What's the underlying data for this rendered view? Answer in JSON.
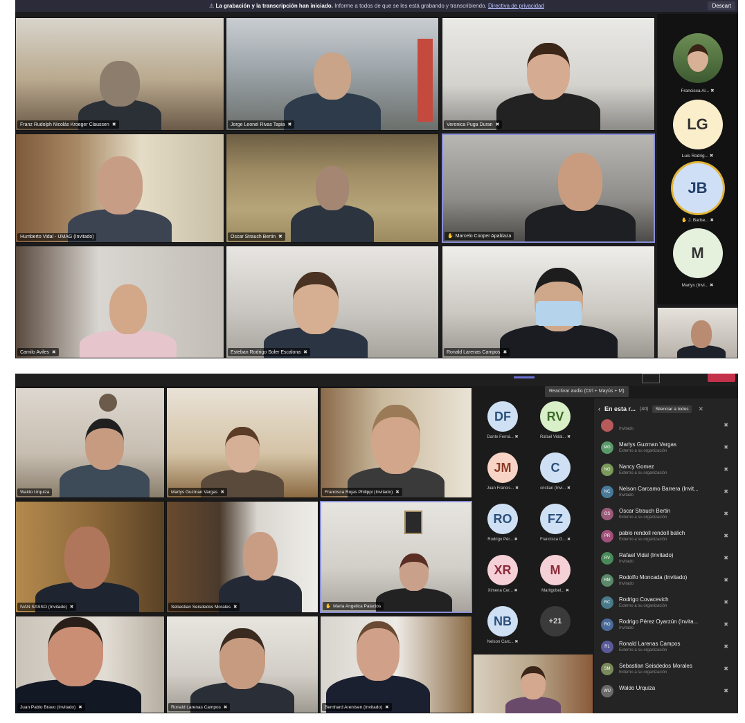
{
  "zoom": {
    "banner": {
      "title": "La grabación y la transcripción han iniciado.",
      "text": "Informe a todos de que se les está grabando y transcribiendo.",
      "link": "Directiva de privacidad",
      "action": "Descart"
    },
    "tiles": [
      {
        "name": "Franz Rudolph Nicolás Kroeger Claussen"
      },
      {
        "name": "Jorge Leonel Rivas Tapia"
      },
      {
        "name": "Veronica Puga Duran"
      },
      {
        "name": "Humberto Vidal - UMAG (Invitado)"
      },
      {
        "name": "Oscar Strauch Bertin"
      },
      {
        "name": "Marcelo Cooper Apablaza"
      },
      {
        "name": "Camilo Aviles"
      },
      {
        "name": "Esteban Rodrigo Soler Escalona"
      },
      {
        "name": "Ronald Larenas Campos"
      }
    ],
    "side": [
      {
        "initials": "",
        "label": "Francisca Al..."
      },
      {
        "initials": "LG",
        "label": "Luis Rodrig..."
      },
      {
        "initials": "JB",
        "label": "J. Barbe..."
      },
      {
        "initials": "M",
        "label": "Marlys (Invi..."
      }
    ]
  },
  "teams": {
    "tooltip": "Reactivar audio (Ctrl + Mayús + M)",
    "tiles": [
      {
        "name": "Waldo Urquiza"
      },
      {
        "name": "Marlys Guzman Vargas"
      },
      {
        "name": "Francisca Rojas Philippi (Invitado)"
      },
      {
        "name": "IVAN SASSO (Invitado)"
      },
      {
        "name": "Sebastian Seisdedos Morales"
      },
      {
        "name": "Maria Angelica Palacios"
      },
      {
        "name": "Juan Pablo Bravo (Invitado)"
      },
      {
        "name": "Ronald Larenas Campos"
      },
      {
        "name": "Bernhard Arentsen (Invitado)"
      }
    ],
    "roster": [
      {
        "initials": "DF",
        "label": "Dante Ferná...",
        "color": "#cfe0f4",
        "text": "#2b4f7a"
      },
      {
        "initials": "RV",
        "label": "Rafael Vidal...",
        "color": "#d8efc8",
        "text": "#3b6a25"
      },
      {
        "initials": "JM",
        "label": "Juan Francis...",
        "color": "#f7d4c6",
        "text": "#8a3b25"
      },
      {
        "initials": "C",
        "label": "cristian (Invi...",
        "color": "#cfe0f4",
        "text": "#2b4f7a"
      },
      {
        "initials": "RO",
        "label": "Rodrigo Pér...",
        "color": "#cfe0f4",
        "text": "#2b4f7a"
      },
      {
        "initials": "FZ",
        "label": "Francisca G...",
        "color": "#cfe0f4",
        "text": "#2b4f7a"
      },
      {
        "initials": "XR",
        "label": "Ximena Cer...",
        "color": "#f5d0d6",
        "text": "#8a2b3b"
      },
      {
        "initials": "M",
        "label": "Maritgobel...",
        "color": "#f5d0d6",
        "text": "#8a2b3b"
      },
      {
        "initials": "NB",
        "label": "Nelson Carc...",
        "color": "#cfe0f4",
        "text": "#2b4f7a"
      },
      {
        "initials": "+21",
        "label": "",
        "color": "#3a3a3a",
        "text": "#ddd"
      }
    ],
    "panel": {
      "title": "En esta r...",
      "count": "(40)",
      "mute_all": "Silenciar a todos",
      "participants": [
        {
          "name": "",
          "status": "Invitado",
          "initials": "",
          "color": "#b95a5a"
        },
        {
          "name": "Marlys Guzman Vargas",
          "status": "Externo a su organización",
          "initials": "MG",
          "color": "#5a9a6a"
        },
        {
          "name": "Nancy Gomez",
          "status": "Externo a su organización",
          "initials": "NG",
          "color": "#7a9a5a"
        },
        {
          "name": "Nelson Carcamo Barrera (Invit...",
          "status": "Invitado",
          "initials": "NC",
          "color": "#4a7a9a"
        },
        {
          "name": "Oscar Strauch Bertin",
          "status": "Externo a su organización",
          "initials": "OS",
          "color": "#9a5a7a"
        },
        {
          "name": "pablo rendoll rendoll balich",
          "status": "Externo a su organización",
          "initials": "PR",
          "color": "#a0507a"
        },
        {
          "name": "Rafael Vidal (Invitado)",
          "status": "Invitado",
          "initials": "RV",
          "color": "#4a8a5a"
        },
        {
          "name": "Rodolfo Moncada (Invitado)",
          "status": "Invitado",
          "initials": "RM",
          "color": "#5a8a6a"
        },
        {
          "name": "Rodrigo Covacevich",
          "status": "Externo a su organización",
          "initials": "RC",
          "color": "#4a7a8a"
        },
        {
          "name": "Rodrigo Pérez Oyarzún (Invita...",
          "status": "Invitado",
          "initials": "RO",
          "color": "#4a6a9a"
        },
        {
          "name": "Ronald Larenas Campos",
          "status": "Externo a su organización",
          "initials": "RL",
          "color": "#5a5a9a"
        },
        {
          "name": "Sebastian Seisdedos Morales",
          "status": "Externo a su organización",
          "initials": "SM",
          "color": "#7a8a5a"
        },
        {
          "name": "Waldo Urquiza",
          "status": "",
          "initials": "WU",
          "color": "#6a6a6a"
        }
      ]
    }
  }
}
